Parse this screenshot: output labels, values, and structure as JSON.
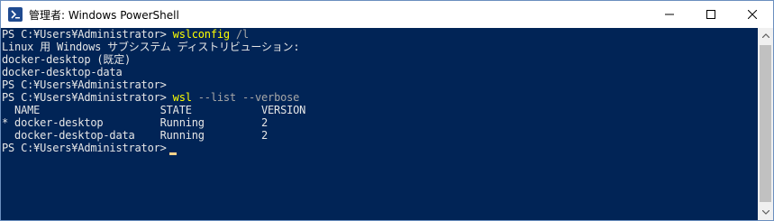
{
  "window": {
    "title": "管理者: Windows PowerShell",
    "controls": {
      "minimize": "minimize",
      "maximize": "maximize",
      "close": "close"
    }
  },
  "console": {
    "lines": [
      {
        "prompt": "PS C:¥Users¥Administrator> ",
        "cmd": "wslconfig",
        "args": " /l",
        "text": ""
      },
      {
        "prompt": "",
        "cmd": "",
        "args": "",
        "text": "Linux 用 Windows サブシステム ディストリビューション:"
      },
      {
        "prompt": "",
        "cmd": "",
        "args": "",
        "text": "docker-desktop (既定)"
      },
      {
        "prompt": "",
        "cmd": "",
        "args": "",
        "text": "docker-desktop-data"
      },
      {
        "prompt": "PS C:¥Users¥Administrator>",
        "cmd": "",
        "args": "",
        "text": ""
      },
      {
        "prompt": "PS C:¥Users¥Administrator> ",
        "cmd": "wsl",
        "args": " --list --verbose",
        "text": ""
      },
      {
        "prompt": "",
        "cmd": "",
        "args": "",
        "text": "  NAME                   STATE           VERSION"
      },
      {
        "prompt": "",
        "cmd": "",
        "args": "",
        "text": "* docker-desktop         Running         2"
      },
      {
        "prompt": "",
        "cmd": "",
        "args": "",
        "text": "  docker-desktop-data    Running         2"
      },
      {
        "prompt": "PS C:¥Users¥Administrator>",
        "cmd": "",
        "args": "",
        "text": "",
        "cursor": true
      }
    ]
  },
  "colors": {
    "console_bg": "#012456",
    "text": "#e6e6e6",
    "command": "#ffff00",
    "parameter": "#a7a7a7",
    "cursor": "#ffd28a"
  }
}
